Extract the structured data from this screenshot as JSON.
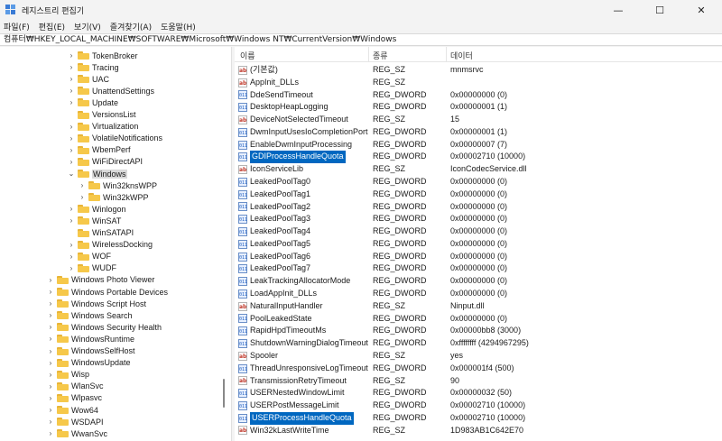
{
  "window": {
    "title": "레지스트리 편집기",
    "minimize": "—",
    "maximize": "☐",
    "close": "✕"
  },
  "menu": [
    "파일(F)",
    "편집(E)",
    "보기(V)",
    "즐겨찾기(A)",
    "도움말(H)"
  ],
  "address": "컴퓨터₩HKEY_LOCAL_MACHINE₩SOFTWARE₩Microsoft₩Windows NT₩CurrentVersion₩Windows",
  "tree": [
    {
      "label": "TokenBroker",
      "level": 3,
      "expand": "collapsed"
    },
    {
      "label": "Tracing",
      "level": 3,
      "expand": "collapsed"
    },
    {
      "label": "UAC",
      "level": 3,
      "expand": "collapsed"
    },
    {
      "label": "UnattendSettings",
      "level": 3,
      "expand": "collapsed"
    },
    {
      "label": "Update",
      "level": 3,
      "expand": "collapsed"
    },
    {
      "label": "VersionsList",
      "level": 3,
      "expand": "none"
    },
    {
      "label": "Virtualization",
      "level": 3,
      "expand": "collapsed"
    },
    {
      "label": "VolatileNotifications",
      "level": 3,
      "expand": "collapsed"
    },
    {
      "label": "WbemPerf",
      "level": 3,
      "expand": "collapsed"
    },
    {
      "label": "WiFiDirectAPI",
      "level": 3,
      "expand": "collapsed"
    },
    {
      "label": "Windows",
      "level": 3,
      "expand": "expanded",
      "selected": true
    },
    {
      "label": "Win32knsWPP",
      "level": 4,
      "expand": "collapsed"
    },
    {
      "label": "Win32kWPP",
      "level": 4,
      "expand": "collapsed"
    },
    {
      "label": "Winlogon",
      "level": 3,
      "expand": "collapsed"
    },
    {
      "label": "WinSAT",
      "level": 3,
      "expand": "collapsed"
    },
    {
      "label": "WinSATAPI",
      "level": 3,
      "expand": "none"
    },
    {
      "label": "WirelessDocking",
      "level": 3,
      "expand": "collapsed"
    },
    {
      "label": "WOF",
      "level": 3,
      "expand": "collapsed"
    },
    {
      "label": "WUDF",
      "level": 3,
      "expand": "collapsed"
    },
    {
      "label": "Windows Photo Viewer",
      "level": 1,
      "expand": "collapsed"
    },
    {
      "label": "Windows Portable Devices",
      "level": 1,
      "expand": "collapsed"
    },
    {
      "label": "Windows Script Host",
      "level": 1,
      "expand": "collapsed"
    },
    {
      "label": "Windows Search",
      "level": 1,
      "expand": "collapsed"
    },
    {
      "label": "Windows Security Health",
      "level": 1,
      "expand": "collapsed"
    },
    {
      "label": "WindowsRuntime",
      "level": 1,
      "expand": "collapsed"
    },
    {
      "label": "WindowsSelfHost",
      "level": 1,
      "expand": "collapsed"
    },
    {
      "label": "WindowsUpdate",
      "level": 1,
      "expand": "collapsed"
    },
    {
      "label": "Wisp",
      "level": 1,
      "expand": "collapsed"
    },
    {
      "label": "WlanSvc",
      "level": 1,
      "expand": "collapsed"
    },
    {
      "label": "Wlpasvc",
      "level": 1,
      "expand": "collapsed"
    },
    {
      "label": "Wow64",
      "level": 1,
      "expand": "collapsed"
    },
    {
      "label": "WSDAPI",
      "level": 1,
      "expand": "collapsed"
    },
    {
      "label": "WwanSvc",
      "level": 1,
      "expand": "collapsed"
    }
  ],
  "columns": {
    "name": "이름",
    "type": "종류",
    "data": "데이터"
  },
  "values": [
    {
      "name": "(기본값)",
      "type": "REG_SZ",
      "data": "mnmsrvc",
      "kind": "sz"
    },
    {
      "name": "AppInit_DLLs",
      "type": "REG_SZ",
      "data": "",
      "kind": "sz"
    },
    {
      "name": "DdeSendTimeout",
      "type": "REG_DWORD",
      "data": "0x00000000 (0)",
      "kind": "dw"
    },
    {
      "name": "DesktopHeapLogging",
      "type": "REG_DWORD",
      "data": "0x00000001 (1)",
      "kind": "dw"
    },
    {
      "name": "DeviceNotSelectedTimeout",
      "type": "REG_SZ",
      "data": "15",
      "kind": "sz"
    },
    {
      "name": "DwmInputUsesIoCompletionPort",
      "type": "REG_DWORD",
      "data": "0x00000001 (1)",
      "kind": "dw"
    },
    {
      "name": "EnableDwmInputProcessing",
      "type": "REG_DWORD",
      "data": "0x00000007 (7)",
      "kind": "dw"
    },
    {
      "name": "GDIProcessHandleQuota",
      "type": "REG_DWORD",
      "data": "0x00002710 (10000)",
      "kind": "dw",
      "highlight": true
    },
    {
      "name": "IconServiceLib",
      "type": "REG_SZ",
      "data": "IconCodecService.dll",
      "kind": "sz"
    },
    {
      "name": "LeakedPoolTag0",
      "type": "REG_DWORD",
      "data": "0x00000000 (0)",
      "kind": "dw"
    },
    {
      "name": "LeakedPoolTag1",
      "type": "REG_DWORD",
      "data": "0x00000000 (0)",
      "kind": "dw"
    },
    {
      "name": "LeakedPoolTag2",
      "type": "REG_DWORD",
      "data": "0x00000000 (0)",
      "kind": "dw"
    },
    {
      "name": "LeakedPoolTag3",
      "type": "REG_DWORD",
      "data": "0x00000000 (0)",
      "kind": "dw"
    },
    {
      "name": "LeakedPoolTag4",
      "type": "REG_DWORD",
      "data": "0x00000000 (0)",
      "kind": "dw"
    },
    {
      "name": "LeakedPoolTag5",
      "type": "REG_DWORD",
      "data": "0x00000000 (0)",
      "kind": "dw"
    },
    {
      "name": "LeakedPoolTag6",
      "type": "REG_DWORD",
      "data": "0x00000000 (0)",
      "kind": "dw"
    },
    {
      "name": "LeakedPoolTag7",
      "type": "REG_DWORD",
      "data": "0x00000000 (0)",
      "kind": "dw"
    },
    {
      "name": "LeakTrackingAllocatorMode",
      "type": "REG_DWORD",
      "data": "0x00000000 (0)",
      "kind": "dw"
    },
    {
      "name": "LoadAppInit_DLLs",
      "type": "REG_DWORD",
      "data": "0x00000000 (0)",
      "kind": "dw"
    },
    {
      "name": "NaturalInputHandler",
      "type": "REG_SZ",
      "data": "Ninput.dll",
      "kind": "sz"
    },
    {
      "name": "PoolLeakedState",
      "type": "REG_DWORD",
      "data": "0x00000000 (0)",
      "kind": "dw"
    },
    {
      "name": "RapidHpdTimeoutMs",
      "type": "REG_DWORD",
      "data": "0x00000bb8 (3000)",
      "kind": "dw"
    },
    {
      "name": "ShutdownWarningDialogTimeout",
      "type": "REG_DWORD",
      "data": "0xffffffff (4294967295)",
      "kind": "dw"
    },
    {
      "name": "Spooler",
      "type": "REG_SZ",
      "data": "yes",
      "kind": "sz"
    },
    {
      "name": "ThreadUnresponsiveLogTimeout",
      "type": "REG_DWORD",
      "data": "0x000001f4 (500)",
      "kind": "dw"
    },
    {
      "name": "TransmissionRetryTimeout",
      "type": "REG_SZ",
      "data": "90",
      "kind": "sz"
    },
    {
      "name": "USERNestedWindowLimit",
      "type": "REG_DWORD",
      "data": "0x00000032 (50)",
      "kind": "dw"
    },
    {
      "name": "USERPostMessageLimit",
      "type": "REG_DWORD",
      "data": "0x00002710 (10000)",
      "kind": "dw"
    },
    {
      "name": "USERProcessHandleQuota",
      "type": "REG_DWORD",
      "data": "0x00002710 (10000)",
      "kind": "dw",
      "highlight": true
    },
    {
      "name": "Win32kLastWriteTime",
      "type": "REG_SZ",
      "data": "1D983AB1C642E70",
      "kind": "sz"
    }
  ],
  "icons": {
    "sz": "ab",
    "dw": "011"
  },
  "colors": {
    "highlight": "#0067c0",
    "folder": "#f6c84a",
    "selection": "#d9d9d9"
  }
}
